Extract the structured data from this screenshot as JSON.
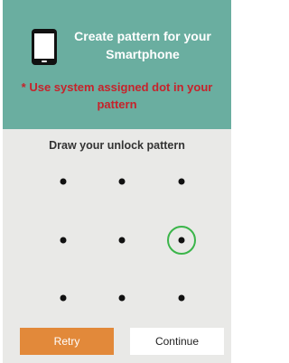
{
  "header": {
    "title": "Create pattern for your Smartphone",
    "warning": "* Use system assigned dot in your pattern",
    "icon": "smartphone-icon"
  },
  "instruction": "Draw your unlock pattern",
  "pattern": {
    "rows": 3,
    "cols": 3,
    "highlighted": {
      "row": 2,
      "col": 3
    },
    "highlight_color": "#3bb54a"
  },
  "buttons": {
    "retry": "Retry",
    "continue": "Continue"
  },
  "colors": {
    "header_bg": "#6aaea0",
    "warning": "#c6232b",
    "retry_bg": "#e2893a"
  }
}
